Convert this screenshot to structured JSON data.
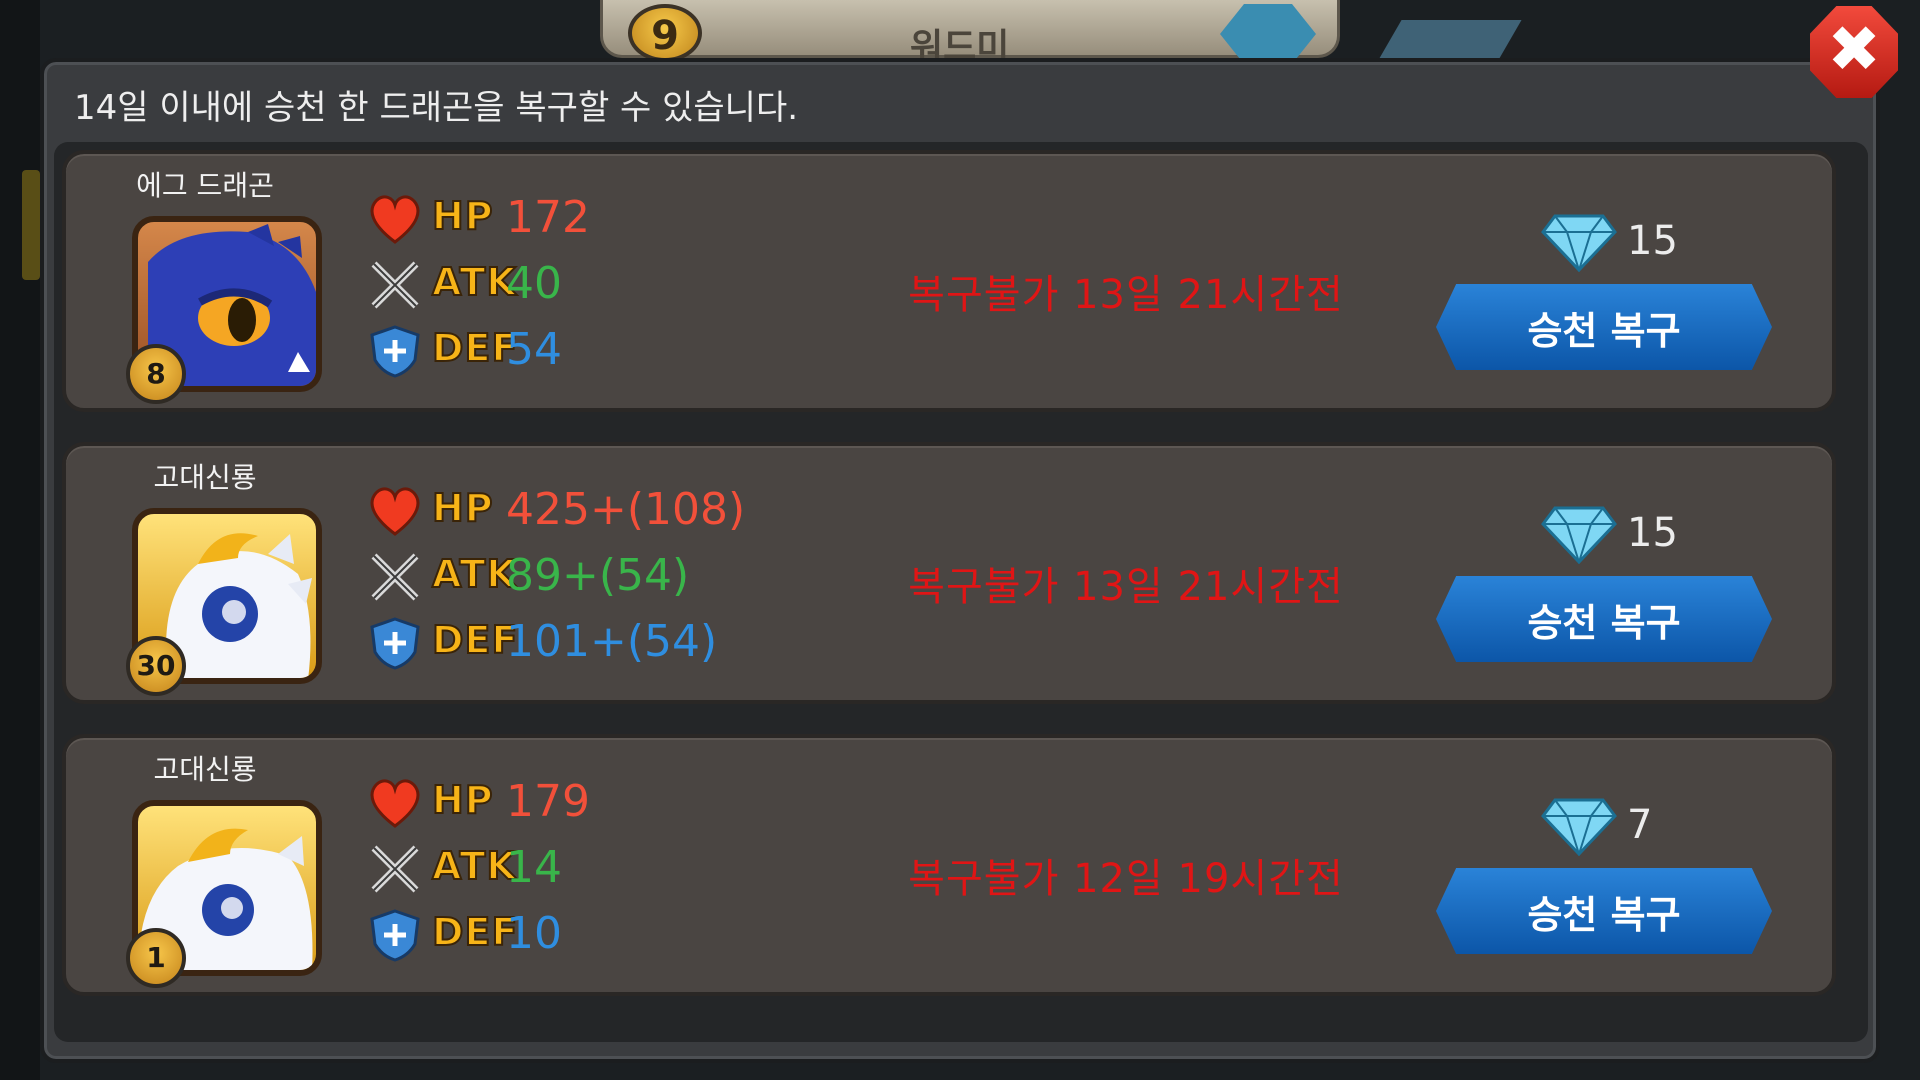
{
  "hud": {
    "level": "9",
    "name": "워드미"
  },
  "dialog": {
    "title": "14일 이내에 승천 한 드래곤을 복구할 수 있습니다.",
    "close_icon": "close-icon",
    "stat_labels": {
      "hp": "HP",
      "atk": "ATK",
      "def": "DEF"
    },
    "rows": [
      {
        "name": "에그 드래곤",
        "level": "8",
        "hp": "172",
        "atk": "40",
        "def": "54",
        "expire": "복구불가 13일 21시간전",
        "cost": "15",
        "button": "승천 복구"
      },
      {
        "name": "고대신룡",
        "level": "30",
        "hp": "425+(108)",
        "atk": "89+(54)",
        "def": "101+(54)",
        "expire": "복구불가 13일 21시간전",
        "cost": "15",
        "button": "승천 복구"
      },
      {
        "name": "고대신룡",
        "level": "1",
        "hp": "179",
        "atk": "14",
        "def": "10",
        "expire": "복구불가 12일 19시간전",
        "cost": "7",
        "button": "승천 복구"
      }
    ]
  },
  "colors": {
    "hp": "#f2503a",
    "atk": "#39b54a",
    "def": "#2f8ee0",
    "expire": "#e01515",
    "button": "#1f6fc2"
  }
}
